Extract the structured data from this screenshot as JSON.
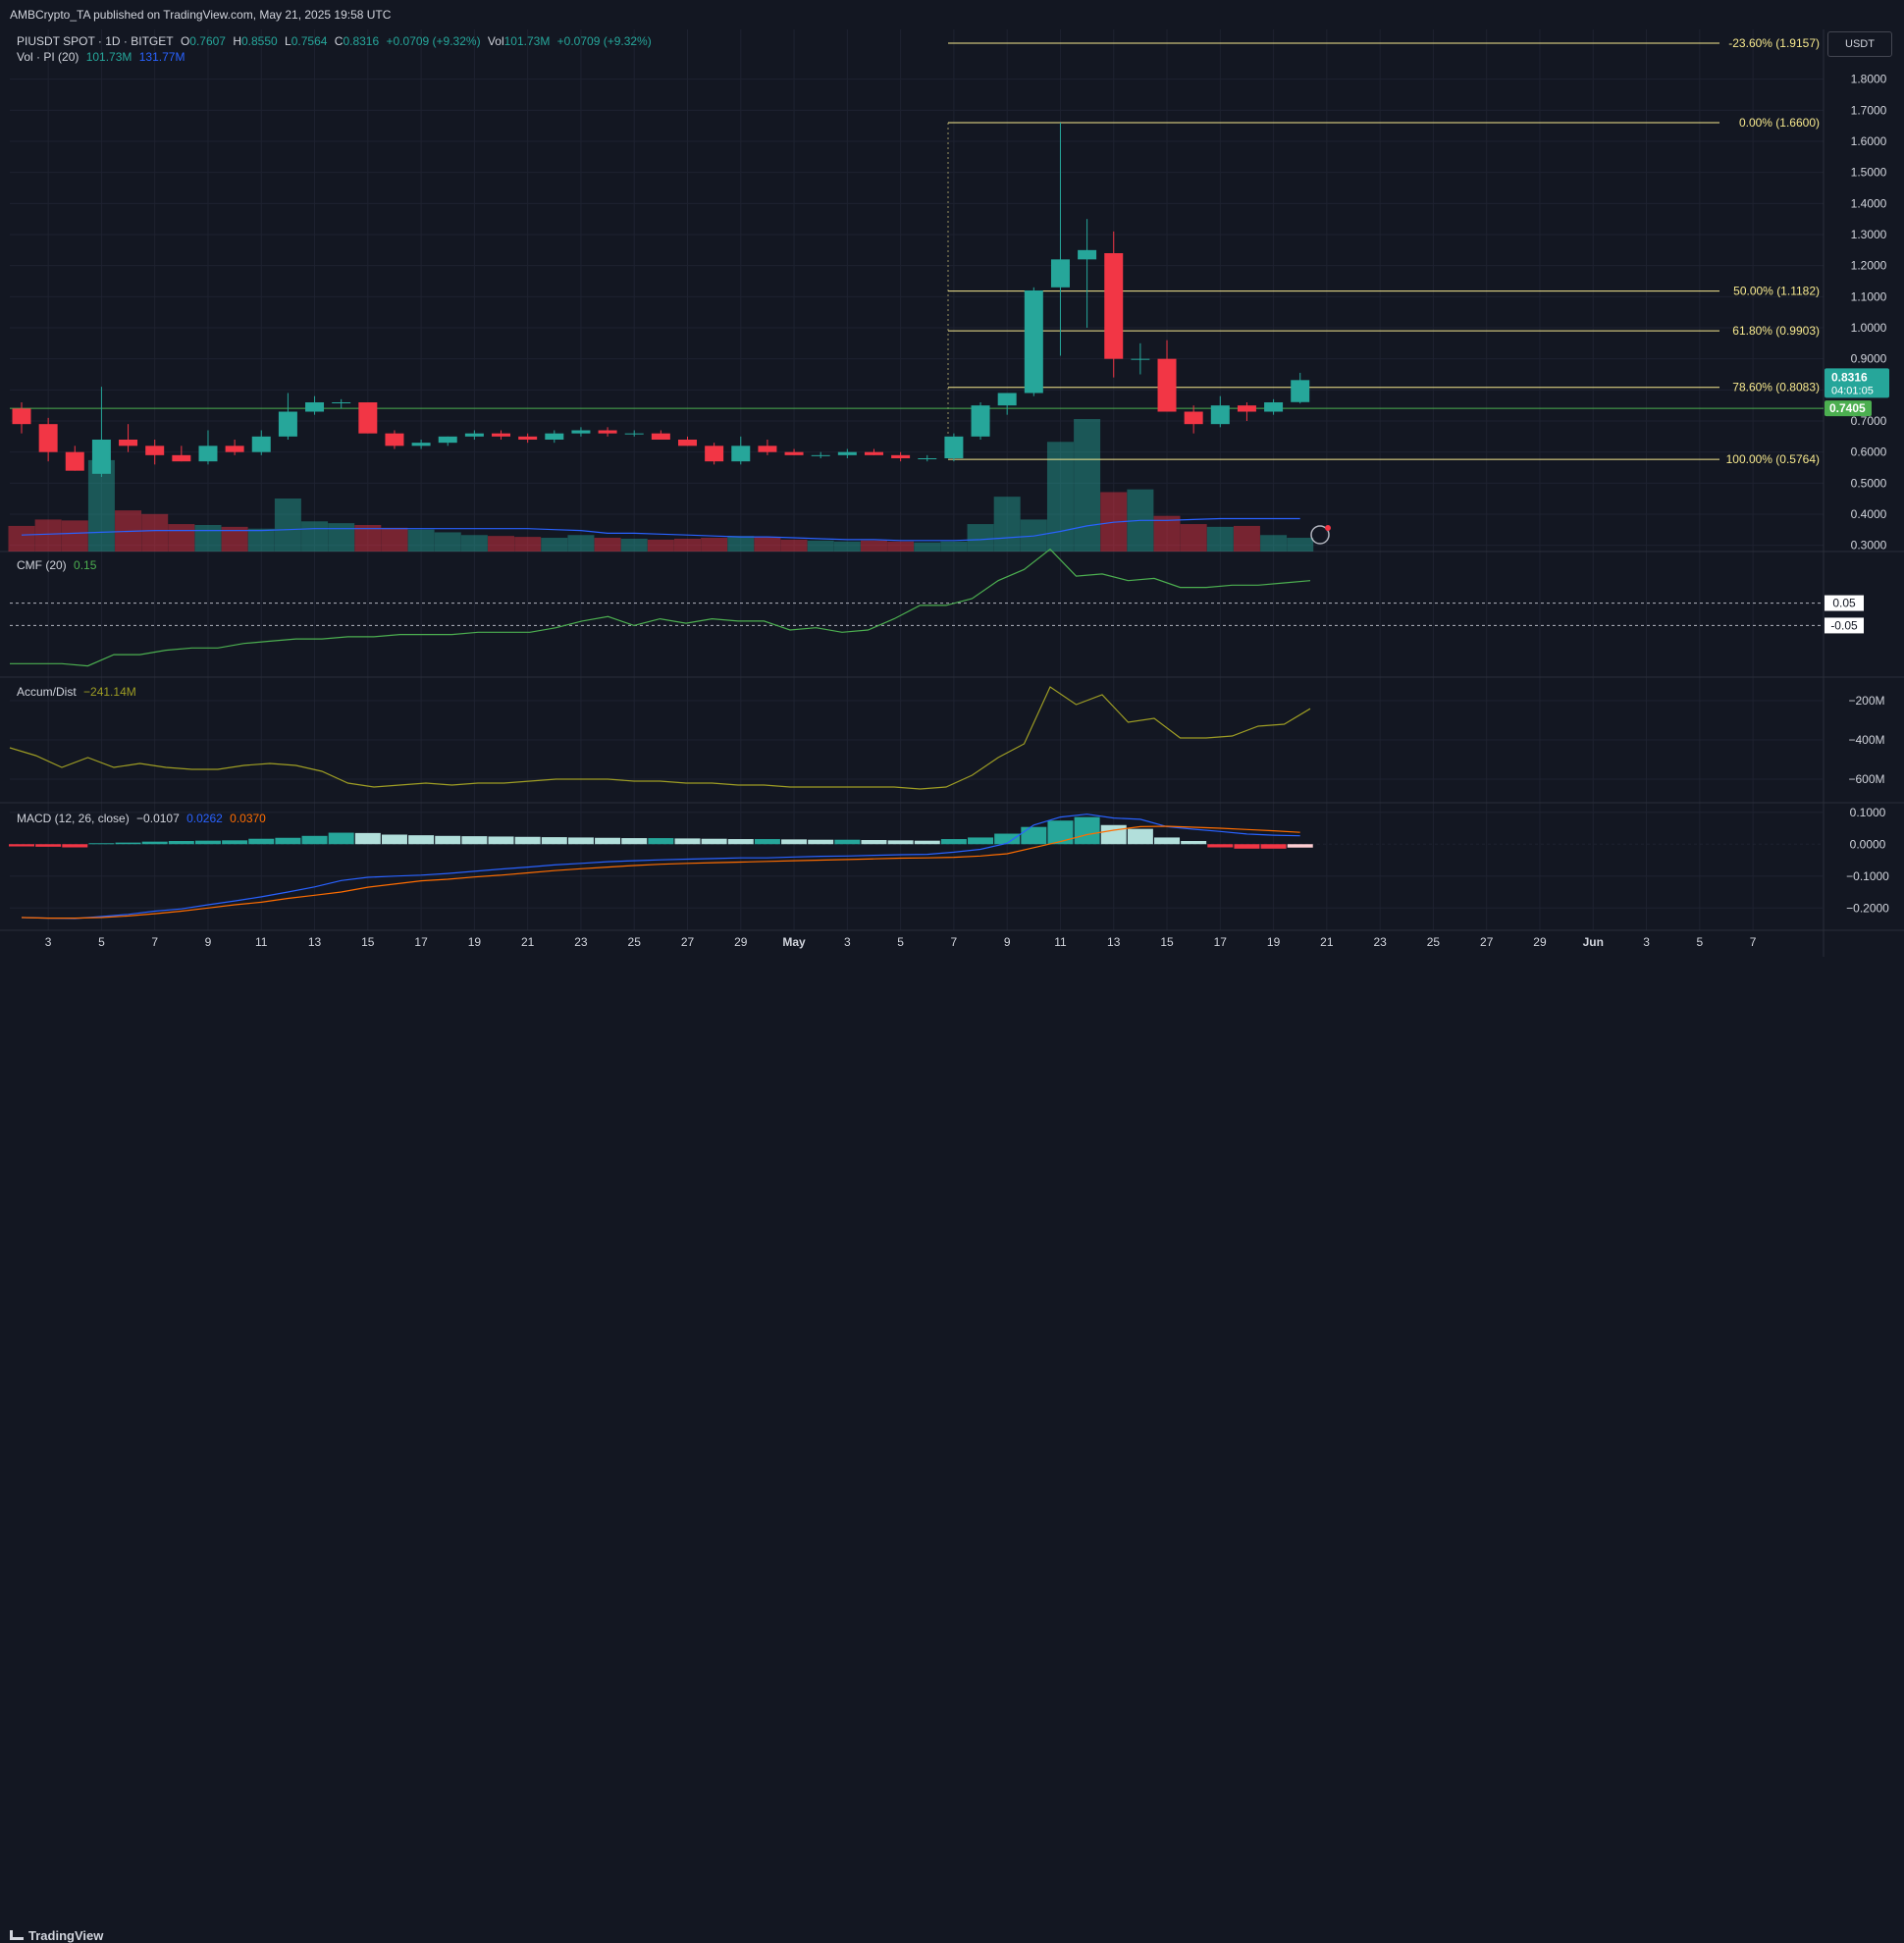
{
  "header": {
    "published": "AMBCrypto_TA published on TradingView.com, May 21, 2025 19:58 UTC"
  },
  "legend": {
    "symbol": "PIUSDT SPOT · 1D · BITGET",
    "o_label": "O",
    "o": "0.7607",
    "h_label": "H",
    "h": "0.8550",
    "l_label": "L",
    "l": "0.7564",
    "c_label": "C",
    "c": "0.8316",
    "change": "+0.0709 (+9.32%)",
    "vol_label": "Vol",
    "vol": "101.73M",
    "vol_change": "+0.0709 (+9.32%)",
    "vol_pi_label": "Vol · PI (20)",
    "vol_pi_val1": "101.73M",
    "vol_pi_val2": "131.77M"
  },
  "currency_button": "USDT",
  "colors": {
    "bg": "#131722",
    "grid": "#1e2230",
    "up": "#26a69a",
    "down": "#f23645",
    "fib": "#f7e98e",
    "green_line": "#4caf50",
    "cmf": "#4caf50",
    "ad": "#9e9d24",
    "macd": "#2962ff",
    "signal": "#ff6d00",
    "vol_ma": "#2962ff",
    "text": "#d1d4dc"
  },
  "price_axis": {
    "ticks": [
      "1.8000",
      "1.7000",
      "1.6000",
      "1.5000",
      "1.4000",
      "1.3000",
      "1.2000",
      "1.1000",
      "1.0000",
      "0.9000",
      "0.8000",
      "0.7000",
      "0.6000",
      "0.5000",
      "0.4000",
      "0.3000"
    ],
    "current_price": "0.8316",
    "countdown": "04:01:05",
    "level_label": "0.7405"
  },
  "fib_levels": [
    {
      "label": "-23.60% (1.9157)",
      "price": 1.9157
    },
    {
      "label": "0.00% (1.6600)",
      "price": 1.66
    },
    {
      "label": "50.00% (1.1182)",
      "price": 1.1182
    },
    {
      "label": "61.80% (0.9903)",
      "price": 0.9903
    },
    {
      "label": "78.60% (0.8083)",
      "price": 0.8083
    },
    {
      "label": "100.00% (0.5764)",
      "price": 0.5764
    }
  ],
  "horizontal_level": 0.7405,
  "x_axis": {
    "labels": [
      "3",
      "5",
      "7",
      "9",
      "11",
      "13",
      "15",
      "17",
      "19",
      "21",
      "23",
      "25",
      "27",
      "29",
      "May",
      "3",
      "5",
      "7",
      "9",
      "11",
      "13",
      "15",
      "17",
      "19",
      "21",
      "23",
      "25",
      "27",
      "29",
      "Jun",
      "3",
      "5",
      "7"
    ]
  },
  "chart_data": [
    {
      "type": "candlestick",
      "title": "PIUSDT SPOT · 1D · BITGET",
      "ylim": [
        0.28,
        1.96
      ],
      "candles": [
        {
          "o": 0.74,
          "h": 0.76,
          "l": 0.66,
          "c": 0.69
        },
        {
          "o": 0.69,
          "h": 0.71,
          "l": 0.57,
          "c": 0.6
        },
        {
          "o": 0.6,
          "h": 0.62,
          "l": 0.54,
          "c": 0.54
        },
        {
          "o": 0.53,
          "h": 0.81,
          "l": 0.52,
          "c": 0.64
        },
        {
          "o": 0.64,
          "h": 0.69,
          "l": 0.6,
          "c": 0.62
        },
        {
          "o": 0.62,
          "h": 0.64,
          "l": 0.56,
          "c": 0.59
        },
        {
          "o": 0.59,
          "h": 0.62,
          "l": 0.57,
          "c": 0.57
        },
        {
          "o": 0.57,
          "h": 0.67,
          "l": 0.56,
          "c": 0.62
        },
        {
          "o": 0.62,
          "h": 0.64,
          "l": 0.59,
          "c": 0.6
        },
        {
          "o": 0.6,
          "h": 0.67,
          "l": 0.59,
          "c": 0.65
        },
        {
          "o": 0.65,
          "h": 0.79,
          "l": 0.64,
          "c": 0.73
        },
        {
          "o": 0.73,
          "h": 0.78,
          "l": 0.72,
          "c": 0.76
        },
        {
          "o": 0.76,
          "h": 0.77,
          "l": 0.74,
          "c": 0.76
        },
        {
          "o": 0.76,
          "h": 0.76,
          "l": 0.66,
          "c": 0.66
        },
        {
          "o": 0.66,
          "h": 0.67,
          "l": 0.61,
          "c": 0.62
        },
        {
          "o": 0.62,
          "h": 0.64,
          "l": 0.61,
          "c": 0.63
        },
        {
          "o": 0.63,
          "h": 0.65,
          "l": 0.62,
          "c": 0.65
        },
        {
          "o": 0.65,
          "h": 0.67,
          "l": 0.64,
          "c": 0.66
        },
        {
          "o": 0.66,
          "h": 0.67,
          "l": 0.64,
          "c": 0.65
        },
        {
          "o": 0.65,
          "h": 0.66,
          "l": 0.63,
          "c": 0.64
        },
        {
          "o": 0.64,
          "h": 0.67,
          "l": 0.63,
          "c": 0.66
        },
        {
          "o": 0.66,
          "h": 0.68,
          "l": 0.65,
          "c": 0.67
        },
        {
          "o": 0.67,
          "h": 0.68,
          "l": 0.65,
          "c": 0.66
        },
        {
          "o": 0.66,
          "h": 0.67,
          "l": 0.65,
          "c": 0.66
        },
        {
          "o": 0.66,
          "h": 0.67,
          "l": 0.64,
          "c": 0.64
        },
        {
          "o": 0.64,
          "h": 0.65,
          "l": 0.62,
          "c": 0.62
        },
        {
          "o": 0.62,
          "h": 0.63,
          "l": 0.56,
          "c": 0.57
        },
        {
          "o": 0.57,
          "h": 0.65,
          "l": 0.56,
          "c": 0.62
        },
        {
          "o": 0.62,
          "h": 0.64,
          "l": 0.59,
          "c": 0.6
        },
        {
          "o": 0.6,
          "h": 0.61,
          "l": 0.59,
          "c": 0.59
        },
        {
          "o": 0.59,
          "h": 0.6,
          "l": 0.58,
          "c": 0.59
        },
        {
          "o": 0.59,
          "h": 0.61,
          "l": 0.58,
          "c": 0.6
        },
        {
          "o": 0.6,
          "h": 0.61,
          "l": 0.59,
          "c": 0.59
        },
        {
          "o": 0.59,
          "h": 0.6,
          "l": 0.57,
          "c": 0.58
        },
        {
          "o": 0.58,
          "h": 0.59,
          "l": 0.57,
          "c": 0.58
        },
        {
          "o": 0.58,
          "h": 0.66,
          "l": 0.57,
          "c": 0.65
        },
        {
          "o": 0.65,
          "h": 0.76,
          "l": 0.64,
          "c": 0.75
        },
        {
          "o": 0.75,
          "h": 0.79,
          "l": 0.72,
          "c": 0.79
        },
        {
          "o": 0.79,
          "h": 1.13,
          "l": 0.78,
          "c": 1.12
        },
        {
          "o": 1.13,
          "h": 1.66,
          "l": 0.91,
          "c": 1.22
        },
        {
          "o": 1.22,
          "h": 1.35,
          "l": 1.0,
          "c": 1.25
        },
        {
          "o": 1.24,
          "h": 1.31,
          "l": 0.84,
          "c": 0.9
        },
        {
          "o": 0.9,
          "h": 0.95,
          "l": 0.85,
          "c": 0.9
        },
        {
          "o": 0.9,
          "h": 0.96,
          "l": 0.74,
          "c": 0.73
        },
        {
          "o": 0.73,
          "h": 0.75,
          "l": 0.66,
          "c": 0.69
        },
        {
          "o": 0.69,
          "h": 0.78,
          "l": 0.68,
          "c": 0.75
        },
        {
          "o": 0.75,
          "h": 0.76,
          "l": 0.7,
          "c": 0.73
        },
        {
          "o": 0.73,
          "h": 0.77,
          "l": 0.72,
          "c": 0.76
        },
        {
          "o": 0.7607,
          "h": 0.855,
          "l": 0.7564,
          "c": 0.8316
        }
      ],
      "volume": [
        0.28,
        0.35,
        0.34,
        1.0,
        0.45,
        0.41,
        0.3,
        0.29,
        0.27,
        0.25,
        0.58,
        0.33,
        0.31,
        0.29,
        0.26,
        0.24,
        0.21,
        0.18,
        0.17,
        0.16,
        0.15,
        0.18,
        0.15,
        0.14,
        0.13,
        0.14,
        0.15,
        0.17,
        0.16,
        0.13,
        0.12,
        0.11,
        0.12,
        0.11,
        0.1,
        0.11,
        0.3,
        0.6,
        0.35,
        1.2,
        1.45,
        0.65,
        0.68,
        0.39,
        0.3,
        0.27,
        0.28,
        0.18,
        0.15
      ],
      "volume_ma": [
        0.18,
        0.19,
        0.2,
        0.21,
        0.22,
        0.23,
        0.23,
        0.23,
        0.23,
        0.23,
        0.24,
        0.25,
        0.25,
        0.25,
        0.25,
        0.25,
        0.25,
        0.25,
        0.25,
        0.25,
        0.24,
        0.23,
        0.2,
        0.2,
        0.19,
        0.18,
        0.17,
        0.16,
        0.16,
        0.15,
        0.14,
        0.13,
        0.13,
        0.12,
        0.12,
        0.12,
        0.13,
        0.15,
        0.17,
        0.22,
        0.28,
        0.32,
        0.34,
        0.34,
        0.35,
        0.36,
        0.36,
        0.36,
        0.36
      ]
    },
    {
      "type": "line",
      "title": "CMF (20)",
      "value_label": "0.15",
      "ylim": [
        -0.28,
        0.28
      ],
      "levels": [
        {
          "label": "0.05",
          "value": 0.05
        },
        {
          "label": "-0.05",
          "value": -0.05
        }
      ],
      "series": [
        {
          "name": "CMF (20)",
          "values": [
            -0.22,
            -0.22,
            -0.22,
            -0.23,
            -0.18,
            -0.18,
            -0.16,
            -0.15,
            -0.15,
            -0.13,
            -0.12,
            -0.11,
            -0.11,
            -0.1,
            -0.1,
            -0.09,
            -0.09,
            -0.09,
            -0.08,
            -0.08,
            -0.08,
            -0.06,
            -0.03,
            -0.01,
            -0.05,
            -0.02,
            -0.04,
            -0.02,
            -0.03,
            -0.03,
            -0.07,
            -0.06,
            -0.08,
            -0.07,
            -0.02,
            0.04,
            0.04,
            0.07,
            0.15,
            0.2,
            0.29,
            0.17,
            0.18,
            0.15,
            0.16,
            0.12,
            0.12,
            0.13,
            0.13,
            0.14,
            0.15
          ]
        }
      ]
    },
    {
      "type": "line",
      "title": "Accum/Dist",
      "value_label": "−241.14M",
      "ylim": [
        -720,
        -80
      ],
      "ticks": [
        "−200M",
        "−400M",
        "−600M"
      ],
      "series": [
        {
          "name": "Accum/Dist",
          "values": [
            -440,
            -480,
            -540,
            -490,
            -540,
            -520,
            -540,
            -550,
            -550,
            -530,
            -520,
            -530,
            -560,
            -620,
            -640,
            -630,
            -620,
            -630,
            -620,
            -620,
            -610,
            -600,
            -600,
            -600,
            -610,
            -610,
            -620,
            -620,
            -630,
            -630,
            -640,
            -640,
            -640,
            -640,
            -640,
            -650,
            -640,
            -580,
            -490,
            -420,
            -130,
            -220,
            -170,
            -310,
            -290,
            -390,
            -390,
            -380,
            -330,
            -320,
            -241
          ]
        }
      ]
    },
    {
      "type": "line",
      "title": "MACD (12, 26, close)",
      "hist_label": "−0.0107",
      "macd_label": "0.0262",
      "signal_label": "0.0370",
      "ylim": [
        -0.27,
        0.13
      ],
      "ticks": [
        "0.1000",
        "0.0000",
        "−0.1000",
        "−0.2000"
      ],
      "series": [
        {
          "name": "MACD",
          "values": [
            -0.23,
            -0.232,
            -0.233,
            -0.227,
            -0.22,
            -0.21,
            -0.203,
            -0.19,
            -0.178,
            -0.165,
            -0.15,
            -0.134,
            -0.114,
            -0.104,
            -0.1,
            -0.097,
            -0.092,
            -0.085,
            -0.078,
            -0.072,
            -0.065,
            -0.06,
            -0.055,
            -0.052,
            -0.049,
            -0.047,
            -0.045,
            -0.043,
            -0.043,
            -0.04,
            -0.038,
            -0.037,
            -0.035,
            -0.033,
            -0.032,
            -0.025,
            -0.016,
            0.003,
            0.06,
            0.085,
            0.094,
            0.082,
            0.078,
            0.055,
            0.047,
            0.04,
            0.032,
            0.028,
            0.0262
          ]
        },
        {
          "name": "Signal",
          "values": [
            -0.23,
            -0.232,
            -0.232,
            -0.23,
            -0.225,
            -0.218,
            -0.21,
            -0.2,
            -0.19,
            -0.182,
            -0.17,
            -0.16,
            -0.15,
            -0.135,
            -0.125,
            -0.115,
            -0.11,
            -0.103,
            -0.097,
            -0.09,
            -0.083,
            -0.077,
            -0.072,
            -0.067,
            -0.063,
            -0.06,
            -0.058,
            -0.056,
            -0.054,
            -0.052,
            -0.05,
            -0.048,
            -0.046,
            -0.044,
            -0.043,
            -0.041,
            -0.037,
            -0.03,
            -0.011,
            0.008,
            0.03,
            0.044,
            0.055,
            0.056,
            0.053,
            0.05,
            0.046,
            0.042,
            0.037
          ]
        }
      ],
      "histogram": [
        -0.007,
        -0.008,
        -0.01,
        0.003,
        0.005,
        0.008,
        0.01,
        0.011,
        0.012,
        0.017,
        0.02,
        0.026,
        0.036,
        0.035,
        0.03,
        0.028,
        0.026,
        0.025,
        0.024,
        0.023,
        0.022,
        0.021,
        0.02,
        0.019,
        0.019,
        0.018,
        0.017,
        0.016,
        0.016,
        0.015,
        0.014,
        0.014,
        0.013,
        0.012,
        0.011,
        0.016,
        0.021,
        0.033,
        0.054,
        0.074,
        0.085,
        0.06,
        0.048,
        0.021,
        0.01,
        -0.01,
        -0.014,
        -0.014,
        -0.0107
      ]
    }
  ]
}
